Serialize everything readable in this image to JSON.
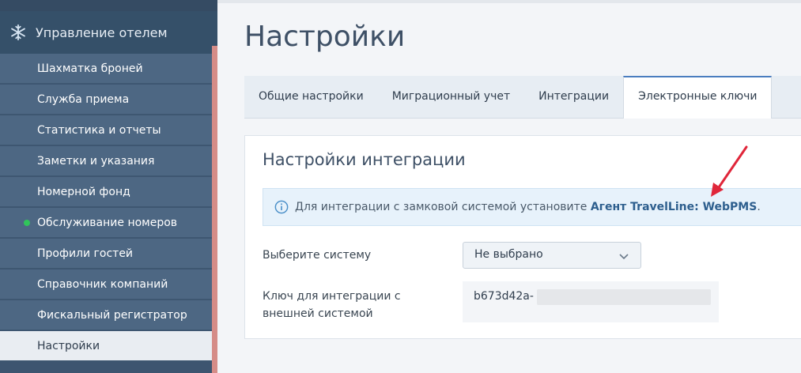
{
  "sidebar": {
    "section_title": "Управление отелем",
    "items": [
      {
        "label": "Шахматка броней"
      },
      {
        "label": "Служба приема"
      },
      {
        "label": "Статистика и отчеты"
      },
      {
        "label": "Заметки и указания"
      },
      {
        "label": "Номерной фонд"
      },
      {
        "label": "Обслуживание номеров",
        "status": "online"
      },
      {
        "label": "Профили гостей"
      },
      {
        "label": "Справочник компаний"
      },
      {
        "label": "Фискальный регистратор"
      },
      {
        "label": "Настройки",
        "active": true
      }
    ]
  },
  "page": {
    "title": "Настройки"
  },
  "tabs": [
    {
      "label": "Общие настройки"
    },
    {
      "label": "Миграционный учет"
    },
    {
      "label": "Интеграции"
    },
    {
      "label": "Электронные ключи",
      "active": true
    }
  ],
  "panel": {
    "title": "Настройки интеграции",
    "info": {
      "prefix": "Для интеграции с замковой системой установите",
      "link": "Агент TravelLine: WebPMS",
      "suffix": "."
    },
    "system_label": "Выберите систему",
    "system_value": "Не выбрано",
    "key_label_line1": "Ключ для интеграции с",
    "key_label_line2": "внешней системой",
    "key_value": "b673d42a-"
  },
  "colors": {
    "sidebar_bg": "#3d5570",
    "sidebar_item_bg": "#4d6783",
    "accent_strip": "#d58c87",
    "active_tab_border": "#4a7dbf",
    "info_bg": "#e7f2fb",
    "arrow": "#e0263a",
    "status_dot": "#30c55a"
  },
  "icons": [
    "snowflake-icon",
    "info-icon",
    "chevron-down-icon"
  ]
}
